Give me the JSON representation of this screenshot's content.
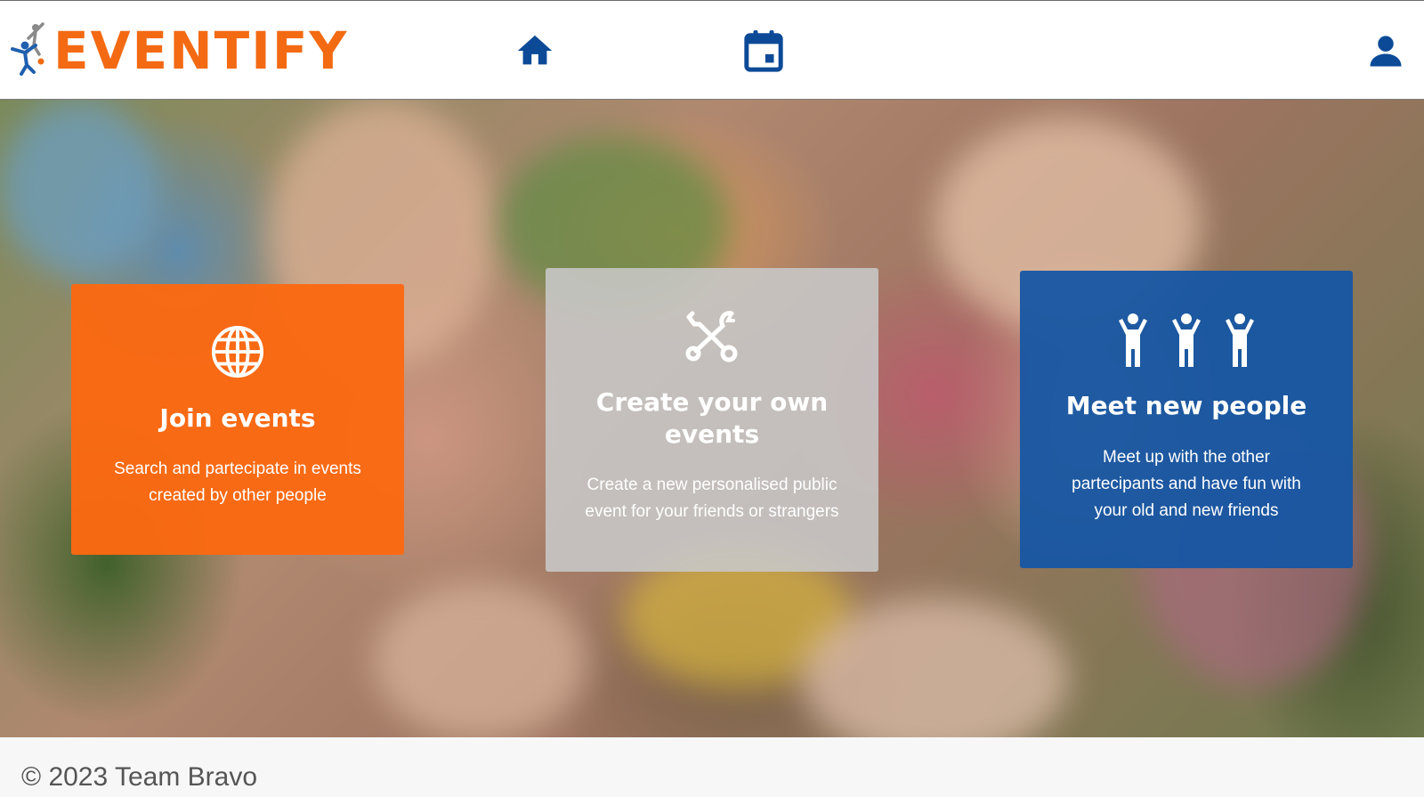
{
  "brand": {
    "name": "EVENTIFY",
    "color": "#f36a13",
    "accent_blue": "#0c4a97"
  },
  "nav": {
    "items": [
      {
        "icon": "home-icon",
        "label": ""
      },
      {
        "icon": "calendar-icon",
        "label": ""
      },
      {
        "icon": "user-icon",
        "label": ""
      }
    ]
  },
  "cards": [
    {
      "icon": "globe-icon",
      "title": "Join events",
      "description": "Search and partecipate in events created by other people",
      "color": "#fb6912"
    },
    {
      "icon": "tools-icon",
      "title": "Create your own events",
      "description": "Create a new personalised public event for your friends or strangers",
      "color": "#c8c8c8"
    },
    {
      "icon": "people-icon",
      "title": "Meet new people",
      "description": "Meet up with the other partecipants and have fun with your old and new friends",
      "color": "#1656a3"
    }
  ],
  "footer": {
    "copyright": "© 2023 Team Bravo"
  }
}
